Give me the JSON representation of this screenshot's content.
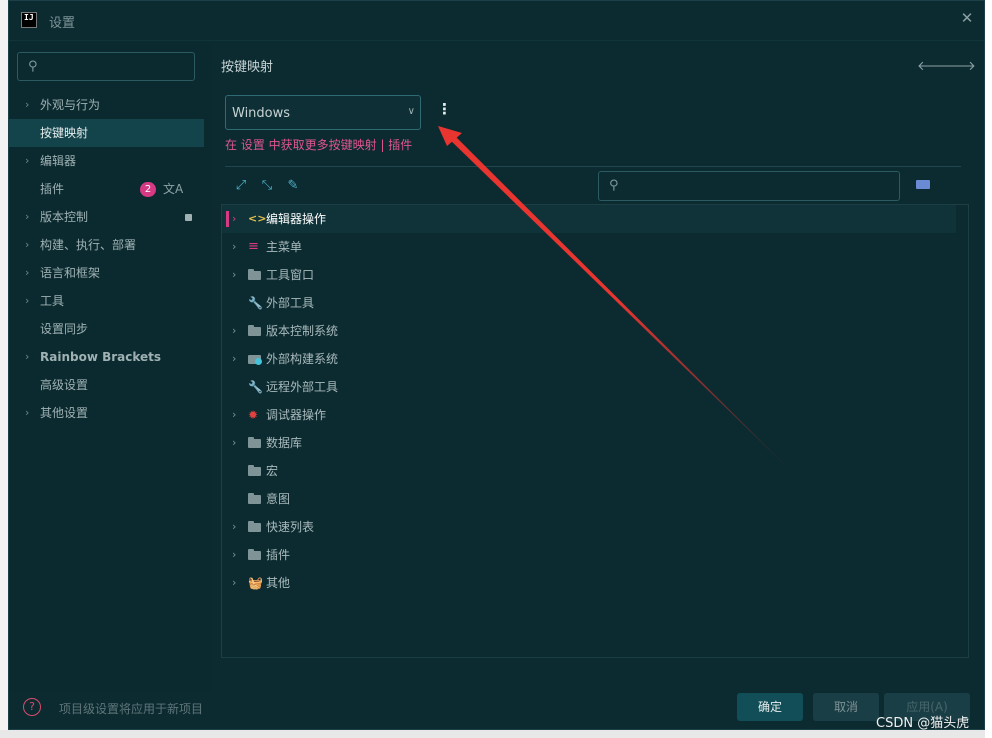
{
  "window": {
    "title": "设置"
  },
  "sidebar": {
    "search_placeholder": "",
    "items": [
      {
        "label": "外观与行为",
        "chevron": true
      },
      {
        "label": "按键映射",
        "chevron": false,
        "active": true
      },
      {
        "label": "编辑器",
        "chevron": true
      },
      {
        "label": "插件",
        "chevron": false,
        "badge": "2"
      },
      {
        "label": "版本控制",
        "chevron": true
      },
      {
        "label": "构建、执行、部署",
        "chevron": true
      },
      {
        "label": "语言和框架",
        "chevron": true
      },
      {
        "label": "工具",
        "chevron": true
      },
      {
        "label": "设置同步",
        "chevron": false
      },
      {
        "label": "Rainbow Brackets",
        "chevron": true
      },
      {
        "label": "高级设置",
        "chevron": false
      },
      {
        "label": "其他设置",
        "chevron": true
      }
    ]
  },
  "main": {
    "heading": "按键映射",
    "keymap_value": "Windows",
    "plugin_link": "在 设置 中获取更多按键映射 | 插件",
    "tree": [
      {
        "label": "编辑器操作",
        "icon": "code-icon",
        "chevron": true,
        "selected": true
      },
      {
        "label": "主菜单",
        "icon": "menu-icon",
        "chevron": true
      },
      {
        "label": "工具窗口",
        "icon": "folder-icon",
        "chevron": true
      },
      {
        "label": "外部工具",
        "icon": "wrench-icon",
        "chevron": false
      },
      {
        "label": "版本控制系统",
        "icon": "folder-icon",
        "chevron": true
      },
      {
        "label": "外部构建系统",
        "icon": "gear-folder-icon",
        "chevron": true
      },
      {
        "label": "远程外部工具",
        "icon": "wrench-icon",
        "chevron": false
      },
      {
        "label": "调试器操作",
        "icon": "bug-icon",
        "chevron": true
      },
      {
        "label": "数据库",
        "icon": "folder-icon",
        "chevron": true
      },
      {
        "label": "宏",
        "icon": "folder-icon",
        "chevron": false
      },
      {
        "label": "意图",
        "icon": "folder-icon",
        "chevron": false
      },
      {
        "label": "快速列表",
        "icon": "folder-icon",
        "chevron": true
      },
      {
        "label": "插件",
        "icon": "folder-icon",
        "chevron": true
      },
      {
        "label": "其他",
        "icon": "basket-icon",
        "chevron": true
      }
    ]
  },
  "footer": {
    "note": "项目级设置将应用于新项目",
    "ok": "确定",
    "cancel": "取消",
    "apply": "应用(A)"
  },
  "watermark": "CSDN @猫头虎",
  "colors": {
    "accent": "#d63a84",
    "background": "#0c2b31",
    "arrow": "#e8352f"
  }
}
